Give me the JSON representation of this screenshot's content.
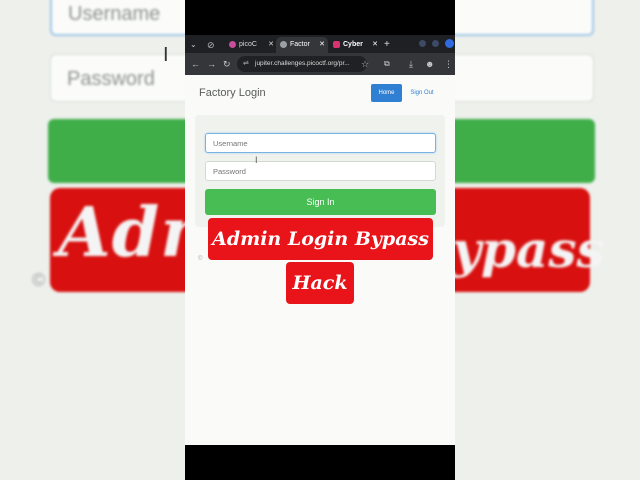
{
  "background": {
    "username_placeholder": "Username",
    "password_placeholder": "Password",
    "overlay_text_left": "Admi",
    "overlay_text_right": "ypass",
    "copyright_glyph": "©"
  },
  "browser": {
    "tabs": [
      {
        "label": "picoC",
        "icon": "picoctf-favicon"
      },
      {
        "label": "Factor",
        "icon": "globe-icon"
      },
      {
        "label": "Cyber",
        "icon": "instagram-icon"
      }
    ],
    "address": "jupiter.challenges.picoctf.org/pr...",
    "new_tab": "+"
  },
  "page": {
    "brand": "Factory Login",
    "nav": {
      "home": "Home",
      "sign_out": "Sign Out"
    },
    "form": {
      "username_placeholder": "Username",
      "password_placeholder": "Password",
      "submit": "Sign In"
    },
    "footer_glyph": "©"
  },
  "overlay": {
    "line1": "Admin Login Bypass",
    "line2": "Hack"
  },
  "colors": {
    "primary_blue": "#2f7fd2",
    "success_green": "#48bd54",
    "overlay_red": "#e8141a"
  }
}
